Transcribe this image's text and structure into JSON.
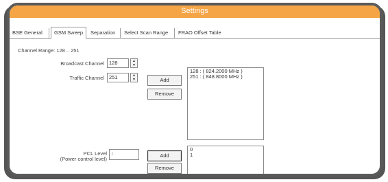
{
  "window": {
    "title": "Settings"
  },
  "tabs": [
    {
      "label": "BSE General",
      "active": false
    },
    {
      "label": "GSM Sweep",
      "active": true
    },
    {
      "label": "Separation",
      "active": false
    },
    {
      "label": "Select Scan Range",
      "active": false
    },
    {
      "label": "FRAO Offset Table",
      "active": false
    }
  ],
  "gsm_sweep": {
    "channel_range_label": "Channel Range: 128 .. 251",
    "broadcast_channel_label": "Broadcast Channel",
    "broadcast_channel_value": "128",
    "traffic_channel_label": "Traffic Channel",
    "traffic_channel_value": "251",
    "add_label": "Add",
    "remove_label": "Remove",
    "traffic_list": [
      "128 : ( 824.2000 MHz )",
      "251 : ( 848.8000 MHz )"
    ],
    "pcl_label_line1": "PCL Level",
    "pcl_label_line2": "(Power control level)",
    "pcl_value": "1",
    "pcl_add_label": "Add",
    "pcl_remove_label": "Remove",
    "pcl_list": [
      "0",
      "1"
    ]
  },
  "icons": {
    "spin_up": "spin-up-arrow-icon",
    "spin_down": "spin-down-arrow-icon"
  },
  "colors": {
    "title_bar": "#f5a545",
    "frame": "#5a5a5a"
  }
}
